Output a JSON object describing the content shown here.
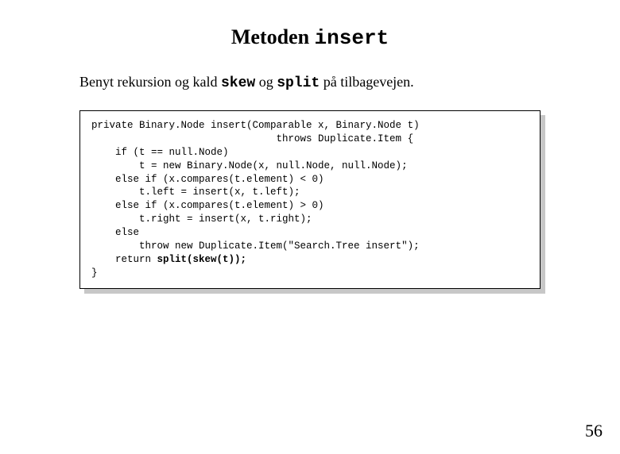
{
  "title": {
    "prefix": "Metoden ",
    "mono": "insert"
  },
  "subtitle": {
    "p1": "Benyt rekursion og kald ",
    "m1": "skew",
    "p2": " og ",
    "m2": "split",
    "p3": " på tilbagevejen."
  },
  "code": {
    "l01a": "private Binary.Node insert(Comparable x, Binary.Node t)",
    "l01b": "                               throws Duplicate.Item {",
    "l02": "    if (t == null.Node)",
    "l03": "        t = new Binary.Node(x, null.Node, null.Node);",
    "l04": "    else if (x.compares(t.element) < 0)",
    "l05": "        t.left = insert(x, t.left);",
    "l06": "    else if (x.compares(t.element) > 0)",
    "l07": "        t.right = insert(x, t.right);",
    "l08": "    else",
    "l09": "        throw new Duplicate.Item(\"Search.Tree insert\");",
    "l10a": "    return ",
    "l10b": "split(skew(t));",
    "l11": "}"
  },
  "pagenum": "56"
}
